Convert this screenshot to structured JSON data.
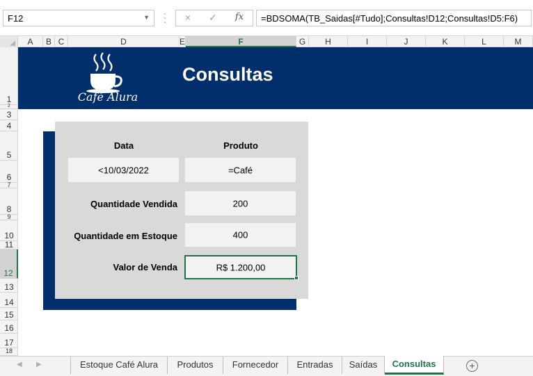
{
  "name_box": {
    "value": "F12"
  },
  "formula_bar": {
    "cancel_icon": "×",
    "enter_icon": "✓",
    "fx_label": "fx",
    "formula": "=BDSOMA(TB_Saidas[#Tudo];Consultas!D12;Consultas!D5:F6)"
  },
  "columns": [
    "A",
    "B",
    "C",
    "D",
    "E",
    "F",
    "G",
    "H",
    "I",
    "J",
    "K",
    "L",
    "M"
  ],
  "active_column": "F",
  "rows": [
    "1",
    "2",
    "3",
    "4",
    "5",
    "6",
    "7",
    "8",
    "9",
    "10",
    "11",
    "12",
    "13",
    "14",
    "15",
    "16",
    "17",
    "18"
  ],
  "active_row": "12",
  "sheet": {
    "logo_text": "Café Alura",
    "title": "Consultas",
    "labels": {
      "data": "Data",
      "produto": "Produto",
      "qtd_vendida": "Quantidade Vendida",
      "qtd_estoque": "Quantidade em Estoque",
      "valor_venda": "Valor de Venda"
    },
    "values": {
      "data": "<10/03/2022",
      "produto": "=Café",
      "qtd_vendida": "200",
      "qtd_estoque": "400",
      "valor_venda": "R$ 1.200,00"
    },
    "colors": {
      "banner": "#002f6c",
      "panel": "#d9d9d9",
      "accent": "#217346"
    }
  },
  "tabs": [
    "Estoque Café Alura",
    "Produtos",
    "Fornecedor",
    "Entradas",
    "Saídas",
    "Consultas"
  ],
  "active_tab": "Consultas",
  "add_sheet_icon": "+"
}
